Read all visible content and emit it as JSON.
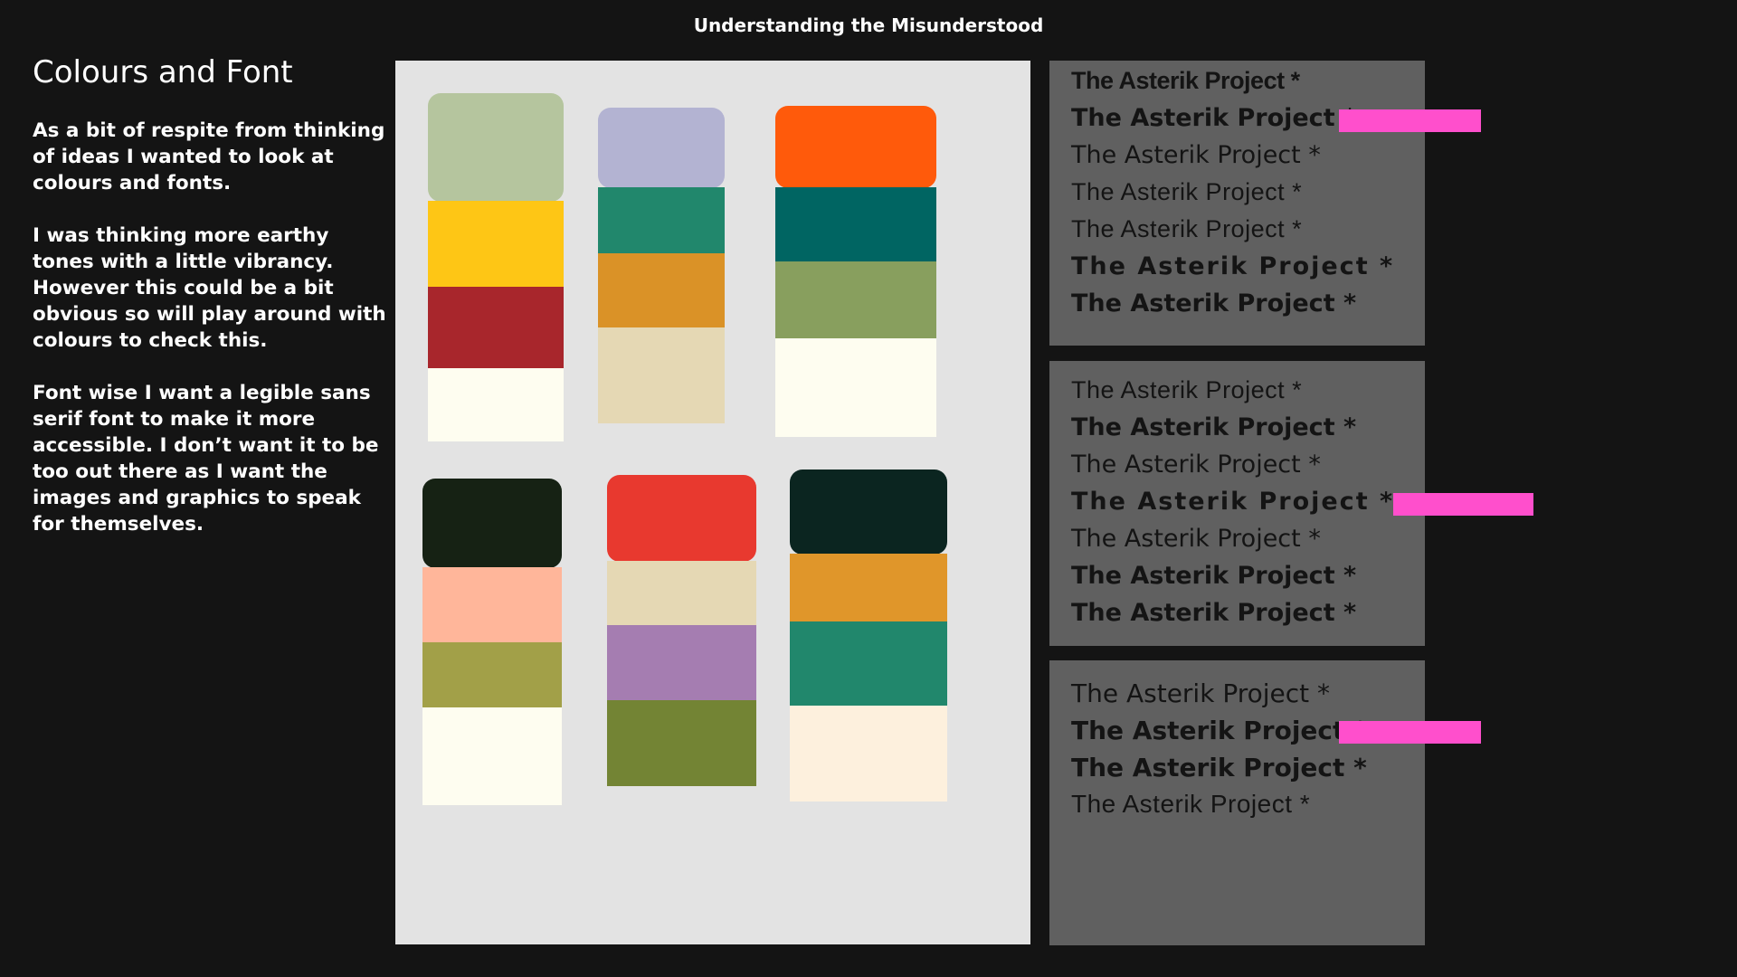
{
  "page": {
    "title": "Understanding the Misunderstood"
  },
  "intro": {
    "heading": "Colours and Font",
    "paragraphs": [
      "As a bit of respite from thinking of ideas I wanted to look at colours and fonts.",
      "I was thinking more earthy tones with a little vibrancy. However this could be a bit obvious so will play around with colours to check this.",
      "Font wise I want a legible sans serif font to make it more accessible. I don’t want it to be too out there as I want the images and graphics to speak for themselves."
    ]
  },
  "palettes": [
    {
      "colors": [
        "#b5c59e",
        "#fec615",
        "#a8262c",
        "#fefdf0"
      ]
    },
    {
      "colors": [
        "#b3b3d2",
        "#21876c",
        "#da9227",
        "#e5d8b4"
      ]
    },
    {
      "colors": [
        "#ff5a0b",
        "#006562",
        "#889f5e",
        "#fefdf0"
      ]
    },
    {
      "colors": [
        "#162214",
        "#ffb69a",
        "#a2a048",
        "#fefdf0"
      ]
    },
    {
      "colors": [
        "#e8392f",
        "#e5d8b4",
        "#a57db1",
        "#738434"
      ]
    },
    {
      "colors": [
        "#0b2520",
        "#e0962a",
        "#21876c",
        "#fdf0dd"
      ]
    }
  ],
  "font_panels": [
    {
      "samples": [
        {
          "text": "The Asterik Project *",
          "weight": "bold",
          "family": "narrow",
          "selected": false
        },
        {
          "text": "The Asterik Project *",
          "weight": "bold",
          "family": "sans",
          "selected": true
        },
        {
          "text": "The Asterik Project *",
          "weight": "normal",
          "family": "sans",
          "selected": false
        },
        {
          "text": "The Asterik Project *",
          "weight": "normal",
          "family": "light",
          "selected": false
        },
        {
          "text": "The Asterik Project *",
          "weight": "normal",
          "family": "light",
          "selected": false
        },
        {
          "text": "The Asterik Project *",
          "weight": "bold",
          "family": "wide",
          "selected": false
        },
        {
          "text": "The Asterik Project *",
          "weight": "bold",
          "family": "sans",
          "selected": false
        }
      ]
    },
    {
      "samples": [
        {
          "text": "The Asterik Project *",
          "weight": "normal",
          "family": "light",
          "selected": false
        },
        {
          "text": "The Asterik Project *",
          "weight": "bold",
          "family": "sans",
          "selected": false
        },
        {
          "text": "The Asterik Project *",
          "weight": "normal",
          "family": "sans",
          "selected": false
        },
        {
          "text": "The Asterik Project *",
          "weight": "bold",
          "family": "wide",
          "selected": true
        },
        {
          "text": "The Asterik Project *",
          "weight": "normal",
          "family": "sans",
          "selected": false
        },
        {
          "text": "The Asterik Project *",
          "weight": "bold",
          "family": "sans",
          "selected": false
        },
        {
          "text": "The Asterik Project *",
          "weight": "bold",
          "family": "sans",
          "selected": false
        }
      ]
    },
    {
      "samples": [
        {
          "text": "The Asterik Project *",
          "weight": "normal",
          "family": "sans",
          "selected": false
        },
        {
          "text": "The Asterik Project *",
          "weight": "bold",
          "family": "sans",
          "selected": true
        },
        {
          "text": "The Asterik Project *",
          "weight": "bold",
          "family": "sans",
          "selected": false
        },
        {
          "text": "The Asterik Project *",
          "weight": "normal",
          "family": "light",
          "selected": false
        }
      ]
    }
  ],
  "colors": {
    "background": "#141414",
    "panel": "#606060",
    "board": "#e3e3e3",
    "highlight": "#ff4fcc",
    "sample_text": "#141414"
  }
}
